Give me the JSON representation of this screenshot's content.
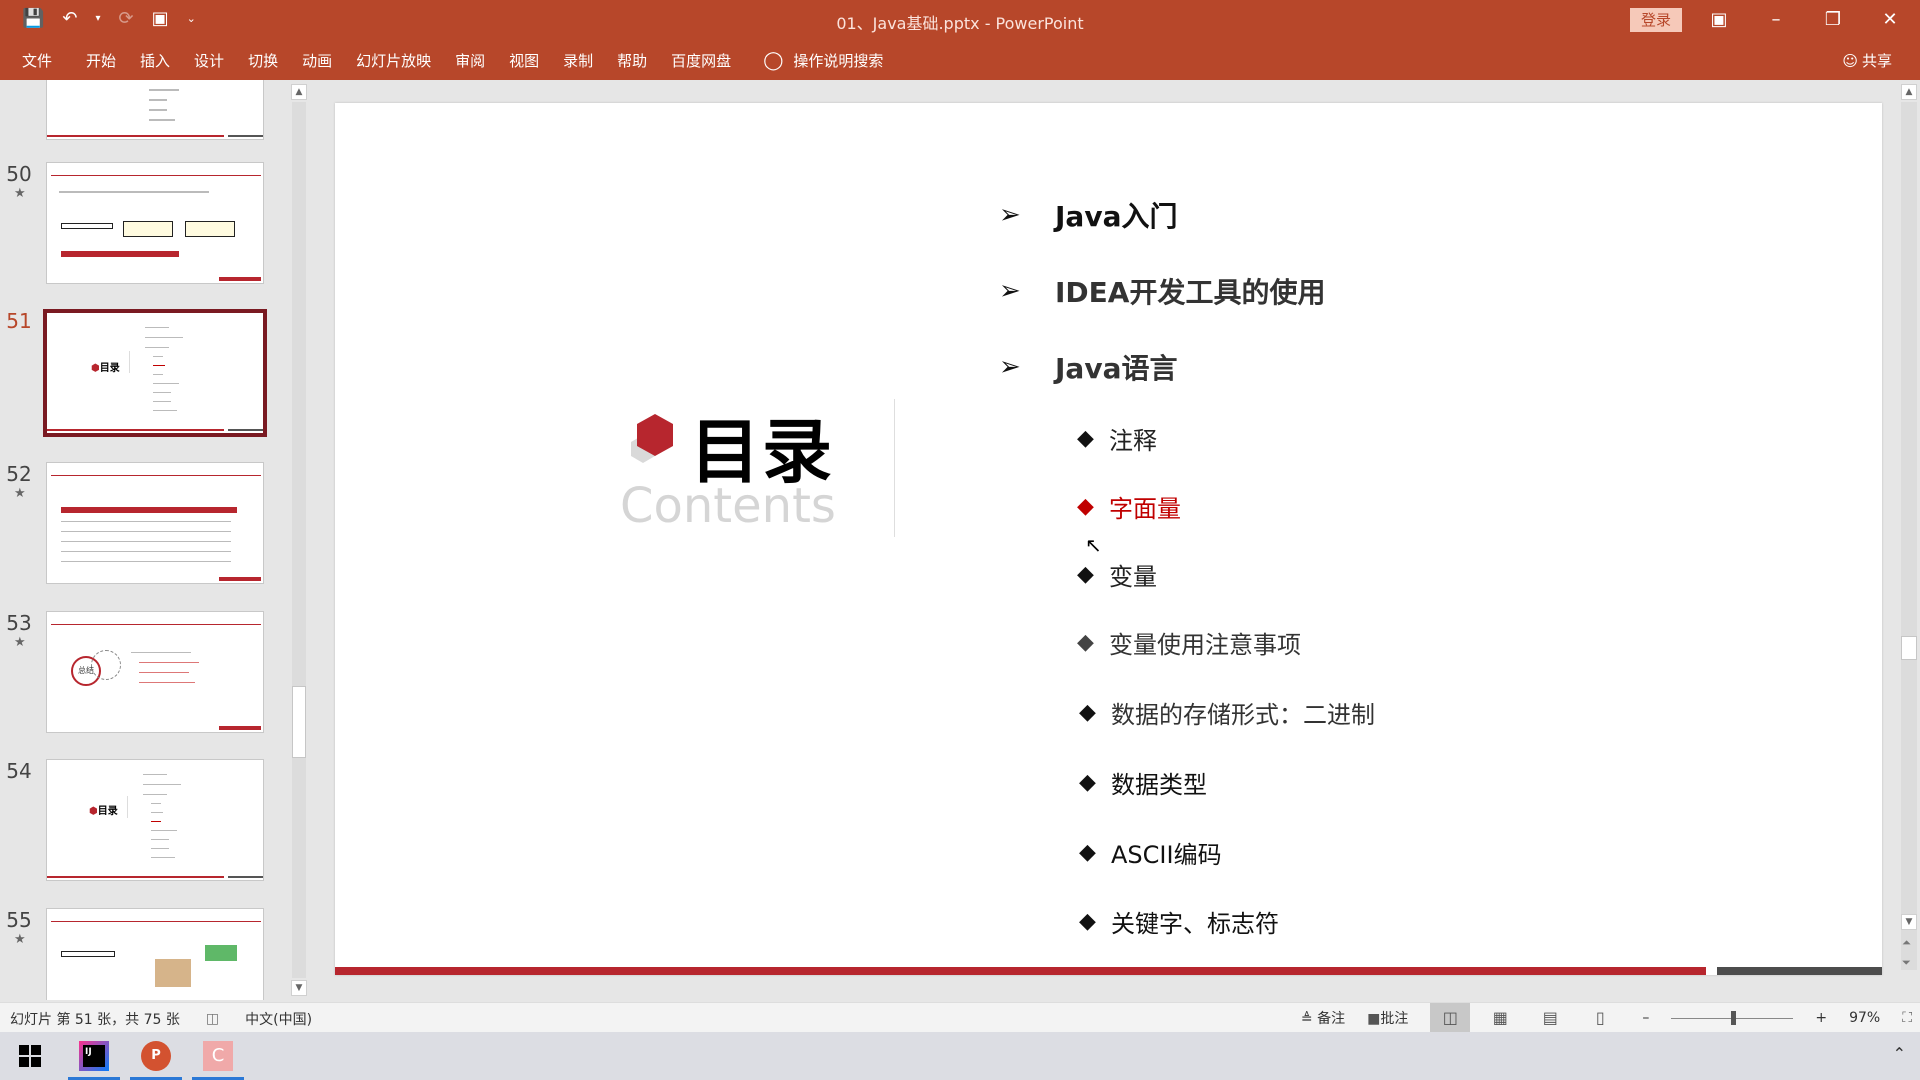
{
  "window": {
    "title": "01、Java基础.pptx  -  PowerPoint",
    "login_label": "登录",
    "controls": [
      "ribbon-display-options",
      "minimize",
      "restore",
      "close"
    ]
  },
  "quick_access": {
    "icons": [
      "save-icon",
      "undo-icon",
      "undo-dropdown-icon",
      "redo-icon",
      "present-from-start-icon",
      "customize-qat-icon"
    ]
  },
  "ribbon": {
    "tabs": [
      "文件",
      "开始",
      "插入",
      "设计",
      "切换",
      "动画",
      "幻灯片放映",
      "审阅",
      "视图",
      "录制",
      "帮助",
      "百度网盘"
    ],
    "tell_me": "操作说明搜索",
    "share": "共享"
  },
  "thumbnails": [
    {
      "number": "",
      "type": "toc-partial",
      "star": false
    },
    {
      "number": "50",
      "type": "content",
      "star": true
    },
    {
      "number": "51",
      "type": "toc",
      "star": false,
      "selected": true
    },
    {
      "number": "52",
      "type": "table",
      "star": true
    },
    {
      "number": "53",
      "type": "summary",
      "star": true,
      "label": "总结"
    },
    {
      "number": "54",
      "type": "toc",
      "star": false
    },
    {
      "number": "55",
      "type": "content",
      "star": true
    }
  ],
  "slide": {
    "title_cn": "目录",
    "title_en": "Contents",
    "sections": [
      {
        "label": "Java入门"
      },
      {
        "label": "IDEA开发工具的使用"
      },
      {
        "label": "Java语言"
      }
    ],
    "subitems": [
      {
        "label": "注释",
        "active": false
      },
      {
        "label": "字面量",
        "active": true
      },
      {
        "label": "变量",
        "active": false
      },
      {
        "label": "变量使用注意事项",
        "active": false
      },
      {
        "label": "数据的存储形式：二进制",
        "active": false
      },
      {
        "label": "数据类型",
        "active": false
      },
      {
        "label": "ASCII编码",
        "active": false
      },
      {
        "label": "关键字、标志符",
        "active": false
      }
    ],
    "accent_color": "#b7262e",
    "active_color": "#c00000"
  },
  "statusbar": {
    "slide_info": "幻灯片 第 51 张，共 75 张",
    "language": "中文(中国)",
    "notes_label": "备注",
    "comments_label": "批注",
    "zoom": "97%",
    "zoom_percent": 97
  },
  "taskbar": {
    "apps": [
      "windows-start",
      "intellij-idea",
      "powerpoint",
      "recorder-app"
    ]
  },
  "theme": {
    "ribbon_color": "#b7472a"
  }
}
